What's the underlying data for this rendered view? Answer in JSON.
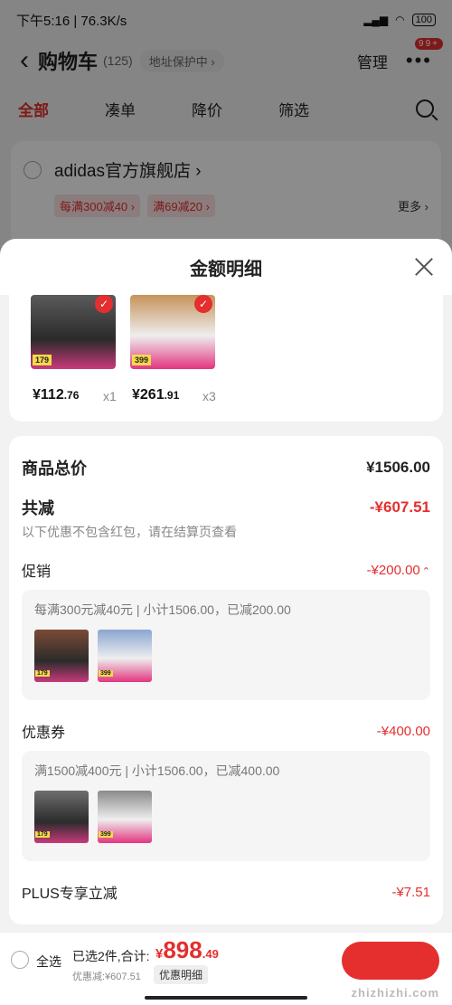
{
  "status_bar": {
    "time": "下午5:16 | 76.3K/s",
    "battery": "100"
  },
  "header": {
    "back_icon": "chevron-left-icon",
    "title": "购物车",
    "count": "(125)",
    "address": "地址保护中 ›",
    "manage": "管理",
    "badge": "99+"
  },
  "tabs": [
    {
      "label": "全部"
    },
    {
      "label": "凑单"
    },
    {
      "label": "降价"
    },
    {
      "label": "筛选"
    }
  ],
  "store": {
    "name": "adidas官方旗舰店 ›",
    "promos": [
      "每满300减40 ›",
      "满69减20 ›"
    ],
    "more": "更多 ›"
  },
  "sheet": {
    "title": "金额明细",
    "items": [
      {
        "price_int": "¥112",
        "price_dec": ".76",
        "qty": "x1",
        "tag": "179",
        "style": "dark"
      },
      {
        "price_int": "¥261",
        "price_dec": ".91",
        "qty": "x3",
        "tag": "399",
        "style": "light"
      }
    ],
    "total_label": "商品总价",
    "total_value": "¥1506.00",
    "reduce_label": "共减",
    "reduce_value": "-¥607.51",
    "note": "以下优惠不包含红包，请在结算页查看",
    "promo": {
      "label": "促销",
      "value": "-¥200.00",
      "desc": "每满300元减40元 | 小计1506.00，已减200.00"
    },
    "coupon": {
      "label": "优惠券",
      "value": "-¥400.00",
      "desc": "满1500减400元 | 小计1506.00，已减400.00"
    },
    "plus": {
      "label": "PLUS专享立减",
      "value": "-¥7.51"
    }
  },
  "bottom": {
    "select_all": "全选",
    "selected": "已选2件,合计:",
    "total_cur": "¥",
    "total_int": "898",
    "total_dec": ".49",
    "discount": "优惠减:¥607.51",
    "detail_btn": "优惠明细",
    "watermark": "zhizhizhi.com"
  }
}
